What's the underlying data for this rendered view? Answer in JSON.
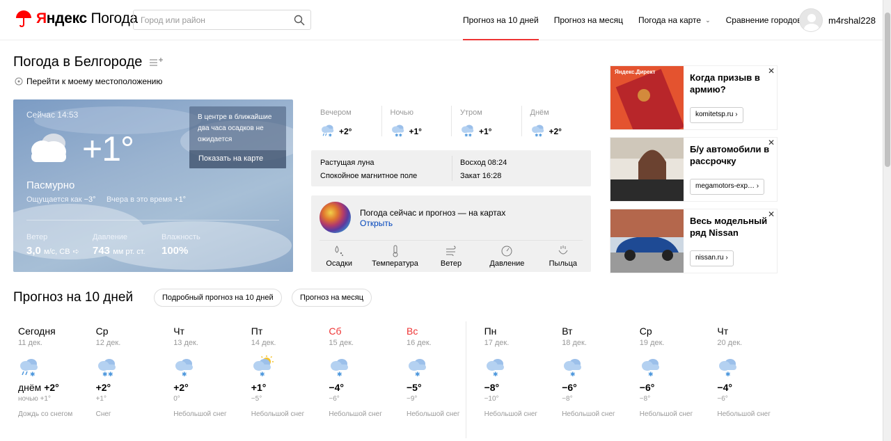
{
  "header": {
    "brand_red": "Я",
    "brand_black": "ндекс",
    "service": "Погода",
    "search_placeholder": "Город или район",
    "nav": [
      {
        "label": "Прогноз на 10 дней",
        "active": true
      },
      {
        "label": "Прогноз на месяц",
        "active": false
      },
      {
        "label": "Погода на карте",
        "active": false,
        "dropdown": true
      },
      {
        "label": "Сравнение городов",
        "active": false
      }
    ],
    "username": "m4rshal228"
  },
  "page": {
    "title": "Погода в Белгороде",
    "locate_link": "Перейти к моему местоположению"
  },
  "now": {
    "time": "Сейчас 14:53",
    "temp": "+1°",
    "condition": "Пасмурно",
    "feels_label": "Ощущается как",
    "feels_value": "−3°",
    "yesterday_label": "Вчера в это время",
    "yesterday_value": "+1°",
    "alert_text": "В центре в ближайшие два часа осадков не ожидается",
    "alert_button": "Показать на карте",
    "wind_label": "Ветер",
    "wind_value": "3,0",
    "wind_unit": "м/с, СВ",
    "pressure_label": "Давление",
    "pressure_value": "743",
    "pressure_unit": "мм рт. ст.",
    "humidity_label": "Влажность",
    "humidity_value": "100%"
  },
  "parts": [
    {
      "name": "Вечером",
      "temp": "+2°",
      "icon": "cloud-snow-rain-icon"
    },
    {
      "name": "Ночью",
      "temp": "+1°",
      "icon": "cloud-snow-icon"
    },
    {
      "name": "Утром",
      "temp": "+1°",
      "icon": "cloud-snow-icon"
    },
    {
      "name": "Днём",
      "temp": "+2°",
      "icon": "cloud-snow-icon"
    }
  ],
  "astro": {
    "moon": "Растущая луна",
    "magnetic": "Спокойное магнитное поле",
    "sunrise": "Восход 08:24",
    "sunset": "Закат 16:28"
  },
  "maps": {
    "title": "Погода сейчас и прогноз — на картах",
    "open": "Открыть",
    "layers": [
      {
        "label": "Осадки",
        "icon": "precipitation-icon"
      },
      {
        "label": "Температура",
        "icon": "thermometer-icon"
      },
      {
        "label": "Ветер",
        "icon": "wind-icon"
      },
      {
        "label": "Давление",
        "icon": "pressure-gauge-icon"
      },
      {
        "label": "Пыльца",
        "icon": "pollen-icon"
      }
    ]
  },
  "ads": [
    {
      "tag": "Яндекс.Директ",
      "title": "Когда призыв в армию?",
      "button": "komitetsp.ru ›"
    },
    {
      "tag": "",
      "title": "Б/у автомобили в рассрочку",
      "button": "megamotors-exp… ›"
    },
    {
      "tag": "",
      "title": "Весь модельный ряд Nissan",
      "button": "nissan.ru ›"
    }
  ],
  "forecast": {
    "title": "Прогноз на 10 дней",
    "detail_button": "Подробный прогноз на 10 дней",
    "month_button": "Прогноз на месяц",
    "days": [
      {
        "name": "Сегодня",
        "date": "11 дек.",
        "temp": "+2°",
        "day_prefix": "днём ",
        "night": "ночью +1°",
        "cond": "Дождь со снегом",
        "weekend": false,
        "icon": "cloud-rain-snow-icon"
      },
      {
        "name": "Ср",
        "date": "12 дек.",
        "temp": "+2°",
        "day_prefix": "",
        "night": "+1°",
        "cond": "Снег",
        "weekend": false,
        "icon": "cloud-snow-icon"
      },
      {
        "name": "Чт",
        "date": "13 дек.",
        "temp": "+2°",
        "day_prefix": "",
        "night": "0°",
        "cond": "Небольшой снег",
        "weekend": false,
        "icon": "cloud-light-snow-icon"
      },
      {
        "name": "Пт",
        "date": "14 дек.",
        "temp": "+1°",
        "day_prefix": "",
        "night": "−5°",
        "cond": "Небольшой снег",
        "weekend": false,
        "icon": "sun-cloud-snow-icon"
      },
      {
        "name": "Сб",
        "date": "15 дек.",
        "temp": "−4°",
        "day_prefix": "",
        "night": "−6°",
        "cond": "Небольшой снег",
        "weekend": true,
        "icon": "cloud-light-snow-icon"
      },
      {
        "name": "Вс",
        "date": "16 дек.",
        "temp": "−5°",
        "day_prefix": "",
        "night": "−9°",
        "cond": "Небольшой снег",
        "weekend": true,
        "icon": "cloud-light-snow-icon"
      },
      {
        "name": "Пн",
        "date": "17 дек.",
        "temp": "−8°",
        "day_prefix": "",
        "night": "−10°",
        "cond": "Небольшой снег",
        "weekend": false,
        "icon": "cloud-light-snow-icon"
      },
      {
        "name": "Вт",
        "date": "18 дек.",
        "temp": "−6°",
        "day_prefix": "",
        "night": "−8°",
        "cond": "Небольшой снег",
        "weekend": false,
        "icon": "cloud-light-snow-icon"
      },
      {
        "name": "Ср",
        "date": "19 дек.",
        "temp": "−6°",
        "day_prefix": "",
        "night": "−8°",
        "cond": "Небольшой снег",
        "weekend": false,
        "icon": "cloud-light-snow-icon"
      },
      {
        "name": "Чт",
        "date": "20 дек.",
        "temp": "−4°",
        "day_prefix": "",
        "night": "−6°",
        "cond": "Небольшой снег",
        "weekend": false,
        "icon": "cloud-light-snow-icon"
      }
    ]
  },
  "colors": {
    "accent": "#e33",
    "link": "#04b",
    "weekend": "#e33"
  }
}
